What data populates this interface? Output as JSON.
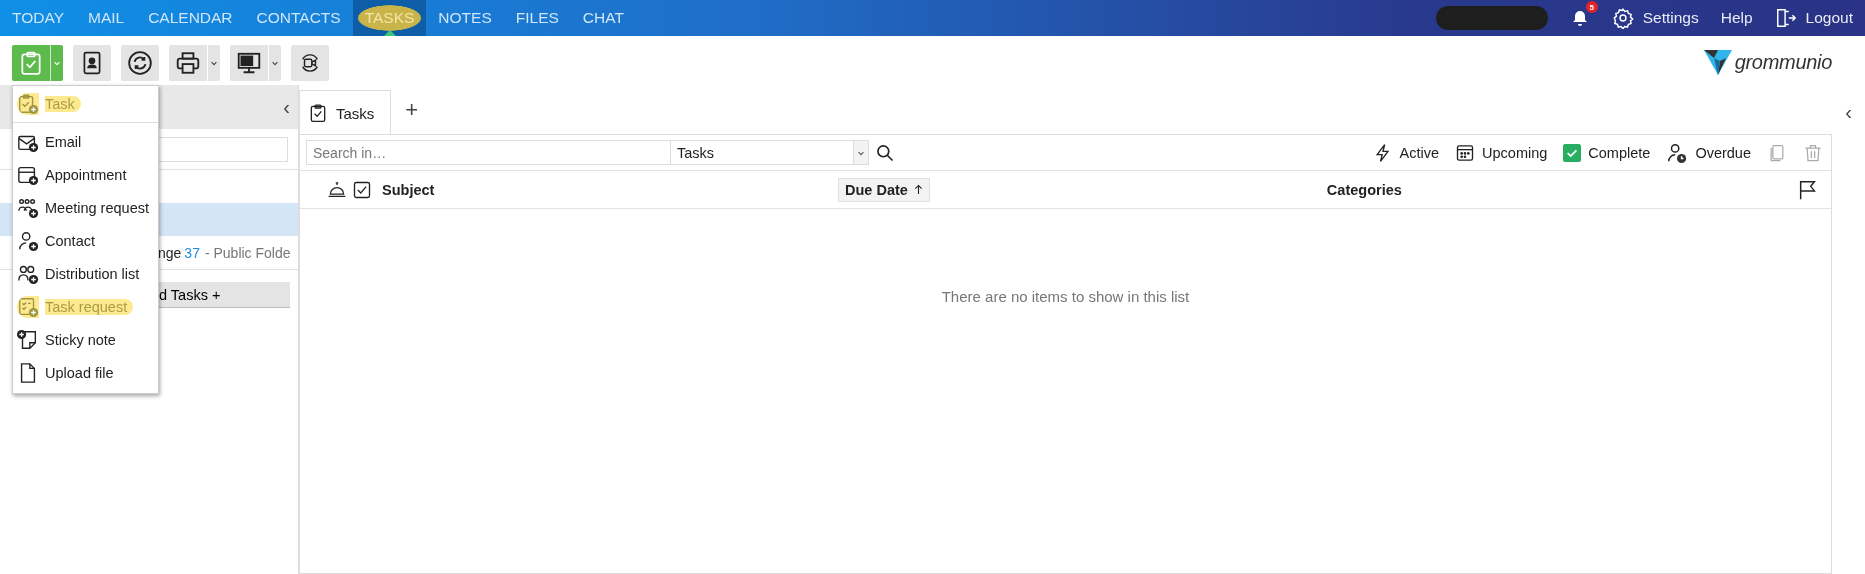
{
  "nav": {
    "tabs": [
      {
        "label": "TODAY",
        "selected": false,
        "highlighted": false
      },
      {
        "label": "MAIL",
        "selected": false,
        "highlighted": false
      },
      {
        "label": "CALENDAR",
        "selected": false,
        "highlighted": false
      },
      {
        "label": "CONTACTS",
        "selected": false,
        "highlighted": false
      },
      {
        "label": "TASKS",
        "selected": true,
        "highlighted": true
      },
      {
        "label": "NOTES",
        "selected": false,
        "highlighted": false
      },
      {
        "label": "FILES",
        "selected": false,
        "highlighted": false
      },
      {
        "label": "CHAT",
        "selected": false,
        "highlighted": false
      }
    ],
    "notification_count": "5",
    "settings": "Settings",
    "help": "Help",
    "logout": "Logout"
  },
  "toolbar": {
    "buttons": [
      {
        "kind": "new-task",
        "split": true
      },
      {
        "kind": "address-book",
        "split": false
      },
      {
        "kind": "sync",
        "split": false
      },
      {
        "kind": "print",
        "split": true
      },
      {
        "kind": "display",
        "split": true
      },
      {
        "kind": "video",
        "split": false
      }
    ]
  },
  "collapse_left": "‹",
  "collapse_right": "‹",
  "logo": {
    "text": "grommunio"
  },
  "new_menu": {
    "items": [
      {
        "label": "Task",
        "kind": "task",
        "highlighted": true
      },
      {
        "label": "Email",
        "kind": "email",
        "highlighted": false
      },
      {
        "label": "Appointment",
        "kind": "appointment",
        "highlighted": false
      },
      {
        "label": "Meeting request",
        "kind": "meeting",
        "highlighted": false
      },
      {
        "label": "Contact",
        "kind": "contact",
        "highlighted": false
      },
      {
        "label": "Distribution list",
        "kind": "distlist",
        "highlighted": false
      },
      {
        "label": "Task request",
        "kind": "taskrequest",
        "highlighted": true
      },
      {
        "label": "Sticky note",
        "kind": "note",
        "highlighted": false
      },
      {
        "label": "Upload file",
        "kind": "file",
        "highlighted": false
      }
    ]
  },
  "sidebar": {
    "rows": [
      {
        "kind": "blank",
        "selected": false
      },
      {
        "kind": "blank",
        "selected": true
      },
      {
        "kind": "folder",
        "name": "nge",
        "count": "37",
        "suffix": "- Public Folde",
        "selected": false
      }
    ],
    "button": "d Tasks +"
  },
  "content": {
    "tabs": [
      {
        "label": "Tasks",
        "selected": true
      }
    ],
    "add_tab": "+",
    "search": {
      "placeholder": "Search in…",
      "scope": "Tasks"
    },
    "filters": [
      {
        "label": "Active",
        "kind": "bolt"
      },
      {
        "label": "Upcoming",
        "kind": "calendar"
      },
      {
        "label": "Complete",
        "kind": "checkbox",
        "checked": true
      },
      {
        "label": "Overdue",
        "kind": "person-clock"
      }
    ],
    "columns": [
      {
        "label": "Subject",
        "sorted": false
      },
      {
        "label": "Due Date",
        "sorted": true
      },
      {
        "label": "Categories",
        "sorted": false
      }
    ],
    "empty_message": "There are no items to show in this list"
  }
}
